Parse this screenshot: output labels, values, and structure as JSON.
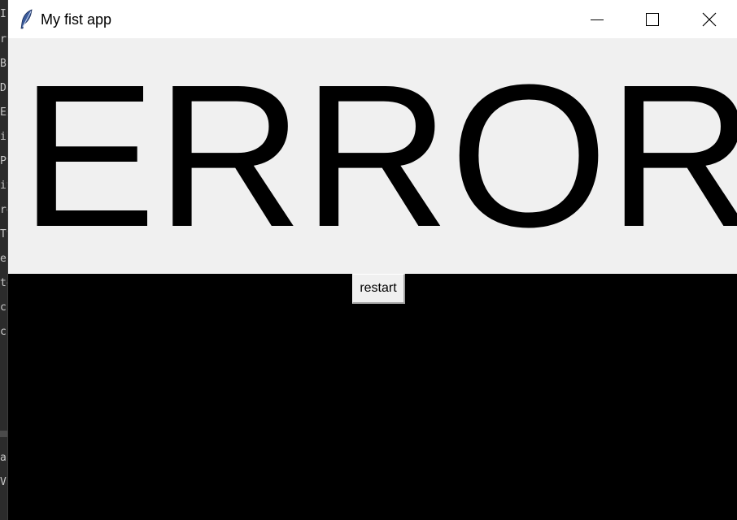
{
  "window": {
    "title": "My fist app",
    "icon": "feather-icon",
    "controls": {
      "minimize_icon": "minimize-icon",
      "maximize_icon": "maximize-icon",
      "close_icon": "close-icon"
    }
  },
  "main": {
    "message": "ERROR",
    "restart_label": "restart"
  },
  "background_editor": {
    "fragments": [
      "I",
      "rt",
      "Bi",
      "D",
      "Ex",
      "il",
      "Py",
      "iti",
      "re",
      "Ty",
      "es",
      "to",
      "c",
      "c",
      "a",
      "V"
    ]
  },
  "colors": {
    "titlebar": "#ffffff",
    "label_background": "#f0f0f0",
    "canvas_background": "#000000",
    "text": "#000000"
  }
}
